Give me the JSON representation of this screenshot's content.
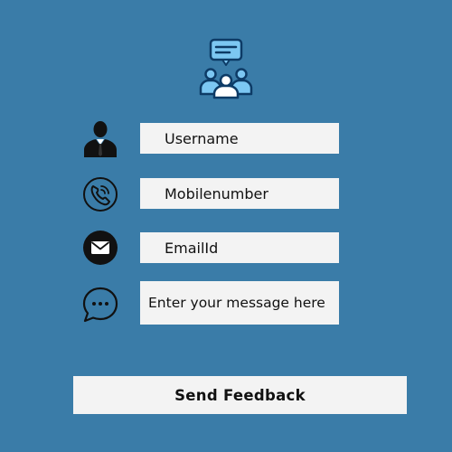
{
  "form": {
    "username_placeholder": "Username",
    "mobile_placeholder": "Mobilenumber",
    "email_placeholder": "EmailId",
    "message_placeholder": "Enter your message here",
    "submit_label": "Send Feedback"
  },
  "icons": {
    "header": "feedback-group-icon",
    "username": "user-icon",
    "mobile": "phone-icon",
    "email": "mail-icon",
    "message": "chat-bubble-icon"
  },
  "colors": {
    "background": "#3a7ca8",
    "field_background": "#f3f3f3",
    "icon_dark": "#111111",
    "header_icon_fill": "#7cc7f2",
    "header_icon_stroke": "#0d3b66"
  }
}
